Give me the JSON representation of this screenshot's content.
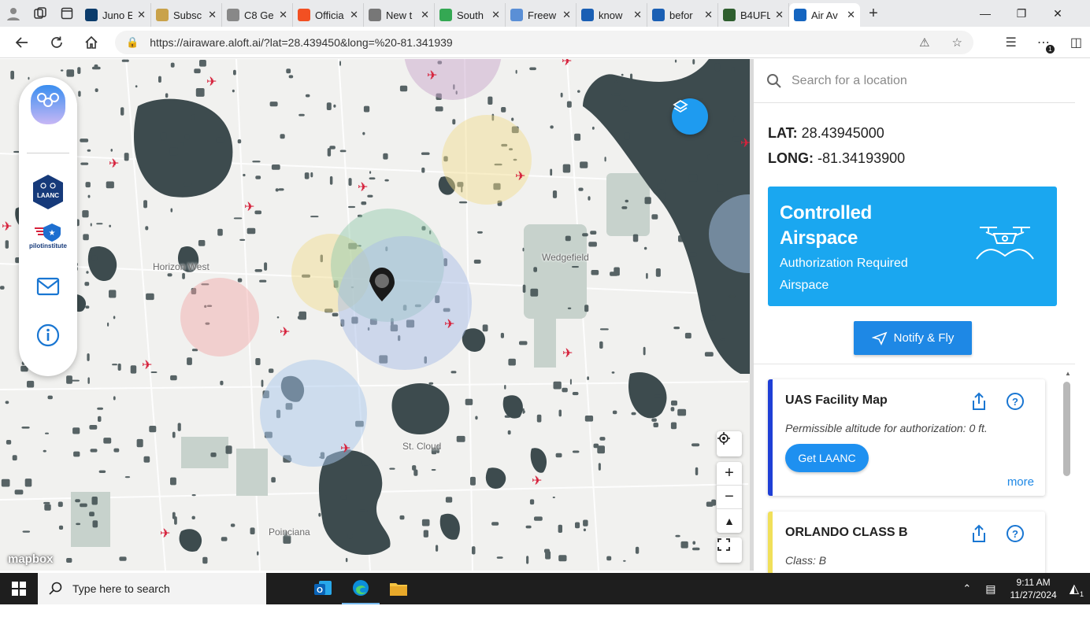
{
  "browser": {
    "tabs": [
      {
        "title": "Juno E",
        "icon": "juno-icon",
        "color": "#0b3b6b"
      },
      {
        "title": "Subsc",
        "icon": "mail-icon",
        "color": "#c9a24a"
      },
      {
        "title": "C8 Ge",
        "icon": "corvette-icon",
        "color": "#888888"
      },
      {
        "title": "Officia",
        "icon": "microsoft-icon",
        "color": "#f25022"
      },
      {
        "title": "New t",
        "icon": "newtab-icon",
        "color": "#777777"
      },
      {
        "title": "South",
        "icon": "maps-icon",
        "color": "#34a853"
      },
      {
        "title": "Freew",
        "icon": "freeway-icon",
        "color": "#5a8fd6"
      },
      {
        "title": "know",
        "icon": "search-icon",
        "color": "#1a5fb4"
      },
      {
        "title": "befor",
        "icon": "search-icon",
        "color": "#1a5fb4"
      },
      {
        "title": "B4UFL",
        "icon": "b4ufly-icon",
        "color": "#2e5e2e"
      },
      {
        "title": "Air Av",
        "icon": "aloft-icon",
        "color": "#1565c0"
      }
    ],
    "url": "https://airaware.aloft.ai/?lat=28.439450&long=%20-81.341939",
    "extensions_badge": "1"
  },
  "map": {
    "labels": {
      "horizon_west": "Horizon West",
      "wedgefield": "Wedgefield",
      "st_cloud": "St. Cloud",
      "poinciana": "Poinciana"
    },
    "attribution": "mapbox",
    "dock": {
      "laanc_text": "LAANC",
      "pilot_institute": "pilotinstitute"
    }
  },
  "panel": {
    "search_placeholder": "Search for a location",
    "lat_label": "LAT:",
    "lat_value": "28.43945000",
    "long_label": "LONG:",
    "long_value": "-81.34193900",
    "status_title": "Controlled Airspace",
    "status_subtitle": "Authorization Required Airspace",
    "status_color": "#1aa7f0",
    "notify_label": "Notify & Fly",
    "cards": [
      {
        "title": "UAS Facility Map",
        "desc": "Permissible altitude for authorization: 0 ft.",
        "button": "Get LAANC",
        "more": "more",
        "bar_color": "#1f3fd6"
      },
      {
        "title": "ORLANDO CLASS B",
        "desc": "Class: B",
        "bar_color": "#f1e05a"
      }
    ]
  },
  "taskbar": {
    "search_placeholder": "Type here to search",
    "time": "9:11 AM",
    "date": "11/27/2024",
    "notification_count": "1"
  }
}
